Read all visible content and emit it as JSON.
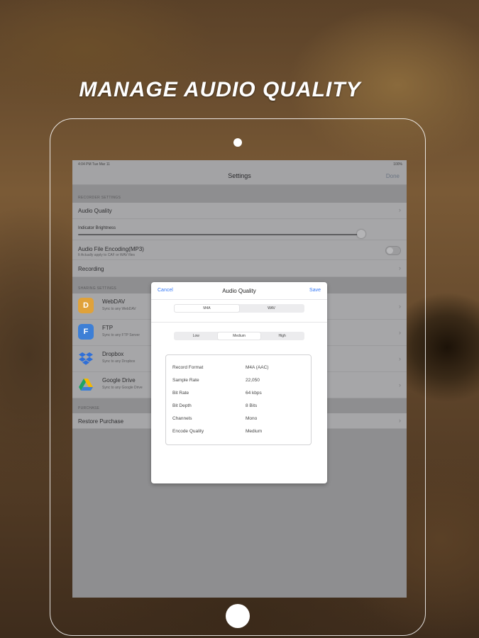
{
  "headline": "MANAGE AUDIO QUALITY",
  "status_bar": {
    "time": "4:04 PM  Tue Mar 11",
    "battery": "100%"
  },
  "nav": {
    "title": "Settings",
    "done_label": "Done"
  },
  "sections": {
    "recorder_settings": "RECORDER SETTINGS",
    "sharing_settings": "SHARING SETTINGS",
    "purchase": "PURCHASE"
  },
  "settings": {
    "audio_quality": "Audio Quality",
    "indicator_brightness": "Indicator Brightness",
    "brightness_level": 0.95,
    "audio_file_encoding": "Audio File Encoding(MP3)",
    "audio_file_encoding_sub": "It Actually apply to CAF or WAV files",
    "audio_file_encoding_on": false,
    "recording": "Recording",
    "restore_purchase": "Restore Purchase"
  },
  "services": [
    {
      "name": "WebDAV",
      "sub": "Sync to any WebDAV",
      "letter": "D",
      "color": "#e0a23a",
      "icon": "webdav-icon"
    },
    {
      "name": "FTP",
      "sub": "Sync to any FTP Server",
      "letter": "F",
      "color": "#3d7fd6",
      "icon": "ftp-icon"
    },
    {
      "name": "Dropbox",
      "sub": "Sync to any Dropbox",
      "letter": "",
      "color": "#2f6fd8",
      "icon": "dropbox-icon"
    },
    {
      "name": "Google Drive",
      "sub": "Sync to any Google Drive",
      "letter": "",
      "color": "#1fa463",
      "icon": "google-drive-icon"
    }
  ],
  "dialog": {
    "cancel_label": "Cancel",
    "title": "Audio Quality",
    "save_label": "Save",
    "format_options": [
      "M4A",
      "WAV"
    ],
    "format_selected": "M4A",
    "quality_options": [
      "Low",
      "Medium",
      "High"
    ],
    "quality_selected": "Medium",
    "details": [
      {
        "key": "Record Format",
        "value": "M4A (AAC)"
      },
      {
        "key": "Sample Rate",
        "value": "22,050"
      },
      {
        "key": "Bit Rate",
        "value": "64 kbps"
      },
      {
        "key": "Bit Depth",
        "value": "8 Bits"
      },
      {
        "key": "Channels",
        "value": "Mono"
      },
      {
        "key": "Encode Quality",
        "value": "Medium"
      }
    ]
  }
}
